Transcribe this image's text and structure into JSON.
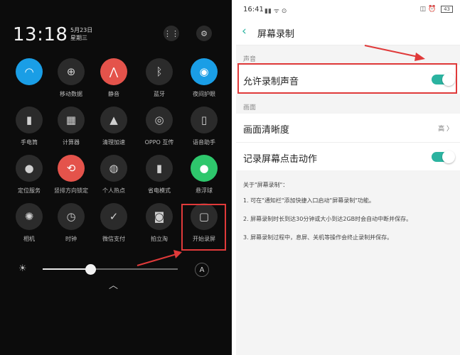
{
  "left_panel": {
    "time": "13:18",
    "date": "5月23日",
    "weekday": "星期三",
    "tiles": [
      {
        "label": "",
        "icon": "wifi-icon",
        "style": "blue"
      },
      {
        "label": "移动数据",
        "icon": "globe-icon",
        "style": "dark"
      },
      {
        "label": "静音",
        "icon": "mute-icon",
        "style": "red"
      },
      {
        "label": "蓝牙",
        "icon": "bluetooth-icon",
        "style": "dark"
      },
      {
        "label": "夜间护眼",
        "icon": "eye-icon",
        "style": "blue"
      },
      {
        "label": "手电筒",
        "icon": "flashlight-icon",
        "style": "dark"
      },
      {
        "label": "计算器",
        "icon": "calculator-icon",
        "style": "dark"
      },
      {
        "label": "清理加速",
        "icon": "rocket-icon",
        "style": "dark"
      },
      {
        "label": "OPPO 互传",
        "icon": "share-icon",
        "style": "dark"
      },
      {
        "label": "语音助手",
        "icon": "mic-icon",
        "style": "dark"
      },
      {
        "label": "定位服务",
        "icon": "location-icon",
        "style": "dark"
      },
      {
        "label": "竖排方向锁定",
        "icon": "rotation-lock-icon",
        "style": "red"
      },
      {
        "label": "个人热点",
        "icon": "hotspot-icon",
        "style": "dark"
      },
      {
        "label": "省电模式",
        "icon": "battery-saver-icon",
        "style": "dark"
      },
      {
        "label": "悬浮球",
        "icon": "floating-ball-icon",
        "style": "green"
      },
      {
        "label": "相机",
        "icon": "camera-aperture-icon",
        "style": "dark"
      },
      {
        "label": "时钟",
        "icon": "clock-icon",
        "style": "dark"
      },
      {
        "label": "微信支付",
        "icon": "wechat-pay-icon",
        "style": "dark"
      },
      {
        "label": "拍立淘",
        "icon": "camera-icon",
        "style": "dark"
      },
      {
        "label": "开始录屏",
        "icon": "screen-record-icon",
        "style": "dark"
      }
    ],
    "brightness_level": 0.35,
    "auto_label": "A"
  },
  "right_panel": {
    "status_time": "16:41",
    "battery": "43",
    "title": "屏幕录制",
    "sections": {
      "sound": "声音",
      "video": "画面"
    },
    "rows": {
      "allow_audio": "允许录制声音",
      "clarity": "画面清晰度",
      "clarity_value": "高",
      "record_taps": "记录屏幕点击动作"
    },
    "about": {
      "title": "关于\"屏幕录制\"：",
      "items": [
        "1. 可在\"通知栏\"添加快捷入口启动\"屏幕录制\"功能。",
        "2. 屏幕录制时长到达30分钟或大小到达2GB时会自动中断并保存。",
        "3. 屏幕录制过程中，息屏、关机等操作会终止录制并保存。"
      ]
    }
  },
  "colors": {
    "accent": "#2bb3a0",
    "highlight": "#e03a3a",
    "tile_blue": "#1a9ee6",
    "tile_red": "#e4534b",
    "tile_green": "#2ec76c"
  }
}
